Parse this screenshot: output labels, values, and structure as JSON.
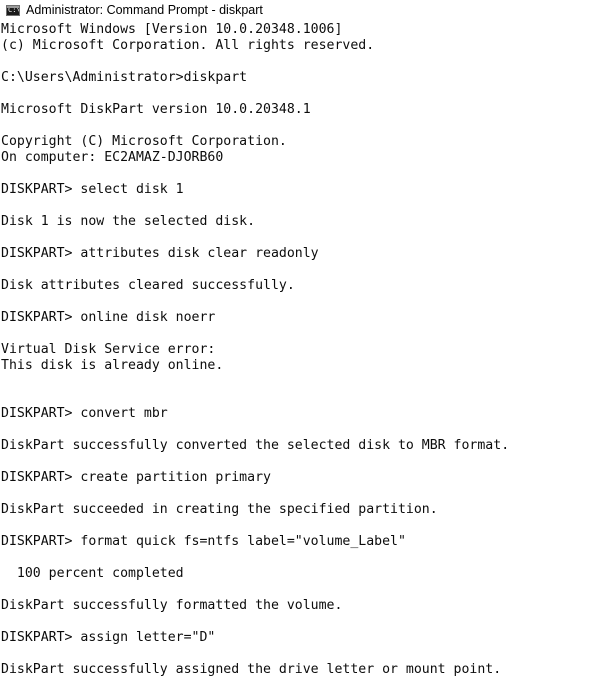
{
  "window": {
    "title": "Administrator: Command Prompt - diskpart",
    "icon": "command-prompt-icon",
    "icon_glyph": "C:\\"
  },
  "console": {
    "lines": [
      "Microsoft Windows [Version 10.0.20348.1006]",
      "(c) Microsoft Corporation. All rights reserved.",
      "C:\\Users\\Administrator>diskpart",
      "Microsoft DiskPart version 10.0.20348.1",
      "Copyright (C) Microsoft Corporation.",
      "On computer: EC2AMAZ-DJORB60",
      "DISKPART> select disk 1",
      "Disk 1 is now the selected disk.",
      "DISKPART> attributes disk clear readonly",
      "Disk attributes cleared successfully.",
      "DISKPART> online disk noerr",
      "Virtual Disk Service error:",
      "This disk is already online.",
      "DISKPART> convert mbr",
      "DiskPart successfully converted the selected disk to MBR format.",
      "DISKPART> create partition primary",
      "DiskPart succeeded in creating the specified partition.",
      "DISKPART> format quick fs=ntfs label=\"volume_Label\"",
      "  100 percent completed",
      "DiskPart successfully formatted the volume.",
      "DISKPART> assign letter=\"D\"",
      "DiskPart successfully assigned the drive letter or mount point."
    ]
  },
  "colors": {
    "background": "#ffffff",
    "text": "#0c0c0c"
  }
}
